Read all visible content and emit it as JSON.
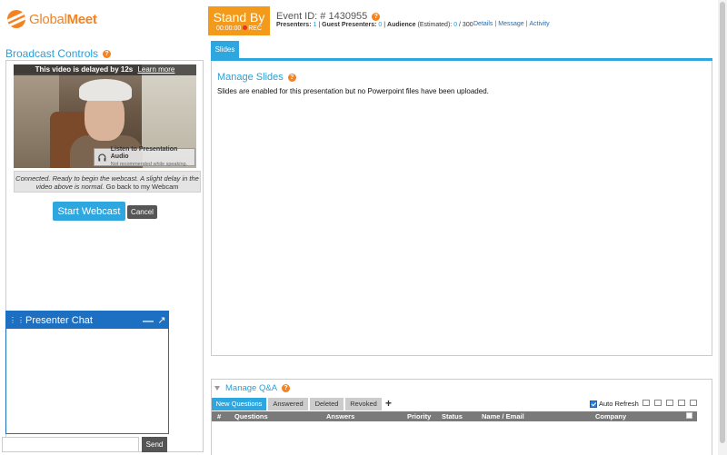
{
  "brand": {
    "name_light": "Global",
    "name_bold": "Meet",
    "accent": "#f58220",
    "primary": "#2ea7e0"
  },
  "broadcast": {
    "title": "Broadcast Controls",
    "delay_banner": "This video is delayed by 12s",
    "learn_more": "Learn more",
    "audio_title": "Listen to Presentation Audio",
    "audio_sub": "Not recommended while speaking.",
    "status_italic": "Connected. Ready to begin the webcast. A slight delay in the video above is normal.",
    "status_link": "Go back to my Webcam",
    "start_label": "Start Webcast",
    "cancel_label": "Cancel"
  },
  "chat": {
    "title": "Presenter Chat",
    "input_placeholder": "",
    "send_label": "Send"
  },
  "status": {
    "label": "Stand By",
    "timer": "00:00:00",
    "rec": "REC"
  },
  "event": {
    "id_label": "Event ID: # 1430955",
    "presenters_label": "Presenters:",
    "presenters_count": "1",
    "guest_label": "Guest Presenters:",
    "guest_count": "0",
    "audience_label": "Audience",
    "audience_note": "(Estimated):",
    "audience_count": "0",
    "audience_max": "/ 300"
  },
  "top_links": {
    "details": "Details",
    "message": "Message",
    "activity": "Activity"
  },
  "slides": {
    "tab": "Slides",
    "title": "Manage Slides",
    "message": "Slides are enabled for this presentation but no Powerpoint files have been uploaded."
  },
  "qa": {
    "title": "Manage Q&A",
    "tabs": [
      "New Questions",
      "Answered",
      "Deleted",
      "Revoked"
    ],
    "plus": "+",
    "auto_refresh": "Auto Refresh",
    "columns": [
      "#",
      "Questions",
      "Answers",
      "Priority",
      "Status",
      "Name / Email",
      "Company"
    ]
  },
  "sep": "|"
}
